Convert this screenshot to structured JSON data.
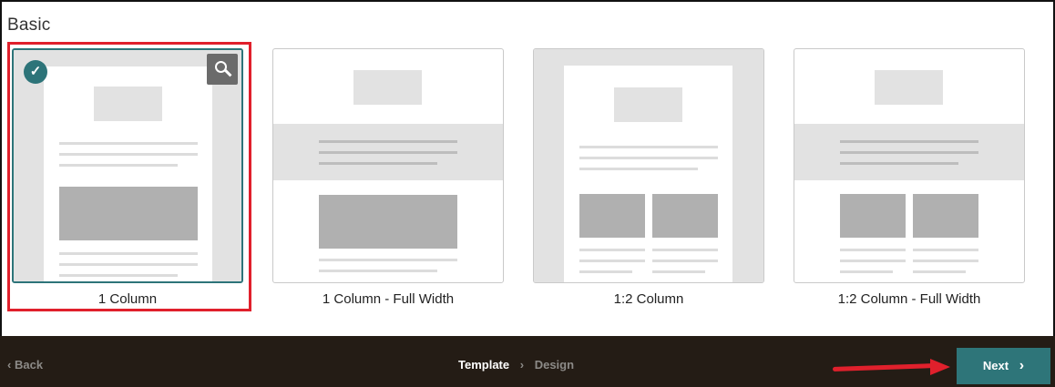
{
  "section": {
    "title": "Basic"
  },
  "templates": [
    {
      "label": "1 Column",
      "selected": true
    },
    {
      "label": "1 Column - Full Width",
      "selected": false
    },
    {
      "label": "1:2 Column",
      "selected": false
    },
    {
      "label": "1:2 Column - Full Width",
      "selected": false
    }
  ],
  "icons": {
    "check": "check-icon",
    "zoom": "magnifier-icon",
    "back": "chevron-left-icon",
    "step_separator": "chevron-right-icon",
    "next": "chevron-right-icon"
  },
  "footer": {
    "back_label": "Back",
    "back_glyph": "‹",
    "steps": [
      {
        "label": "Template",
        "active": true
      },
      {
        "label": "Design",
        "active": false
      }
    ],
    "step_separator": "›",
    "next_label": "Next",
    "next_glyph": "›"
  },
  "colors": {
    "accent": "#2e7579",
    "footer_bg": "#241c15",
    "annotation_red": "#e0202c"
  }
}
